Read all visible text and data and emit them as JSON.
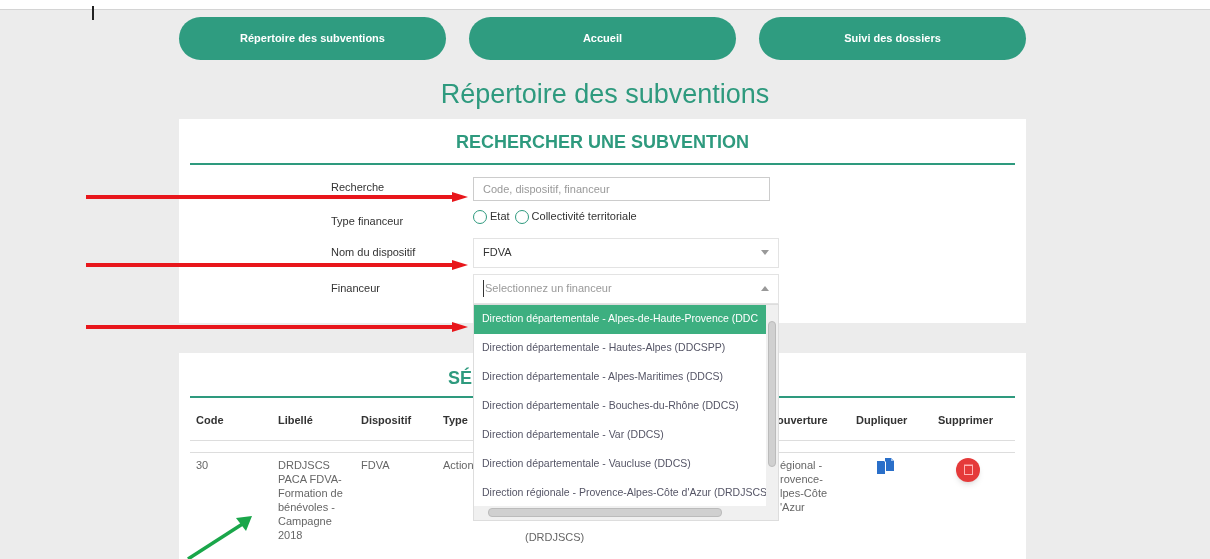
{
  "nav": [
    "Répertoire des subventions",
    "Accueil",
    "Suivi des dossiers"
  ],
  "title": "Répertoire des subventions",
  "search_card": {
    "heading": "RECHERCHER UNE SUBVENTION",
    "fields": [
      {
        "kind": "text",
        "label": "Recherche",
        "placeholder": "Code, dispositif, financeur"
      },
      {
        "kind": "radio",
        "label": "Type financeur",
        "options": [
          {
            "label": "Etat",
            "selected": false
          },
          {
            "label": "Collectivité territoriale",
            "selected": false
          }
        ]
      },
      {
        "kind": "select",
        "label": "Nom du dispositif",
        "value": "FDVA",
        "expanded": false
      },
      {
        "kind": "select",
        "label": "Financeur",
        "placeholder": "Selectionnez un financeur",
        "expanded": true,
        "options": [
          {
            "label": "Direction départementale - Alpes-de-Haute-Provence (DDC",
            "selected": true
          },
          {
            "label": "Direction départementale - Hautes-Alpes (DDCSPP)",
            "selected": false
          },
          {
            "label": "Direction départementale - Alpes-Maritimes (DDCS)",
            "selected": false
          },
          {
            "label": "Direction départementale - Bouches-du-Rhône (DDCS)",
            "selected": false
          },
          {
            "label": "Direction départementale - Var (DDCS)",
            "selected": false
          },
          {
            "label": "Direction départementale - Vaucluse (DDCS)",
            "selected": false
          },
          {
            "label": "Direction régionale - Provence-Alpes-Côte d'Azur (DRDJSCS",
            "selected": false
          }
        ]
      }
    ]
  },
  "results_card": {
    "heading": "SÉ",
    "columns": [
      "Code",
      "Libellé",
      "Dispositif",
      "Type",
      "ouverture",
      "Dupliquer",
      "Supprimer"
    ],
    "rows": [
      {
        "code": "30",
        "libelle": "DRDJSCS PACA FDVA-Formation de bénévoles - Campagne 2018",
        "dispositif": "FDVA",
        "type": "Action",
        "financeur": "(DRDJSCS)",
        "ouverture": [
          "égional -",
          "rovence-",
          "lpes-Côte",
          "'Azur"
        ]
      }
    ]
  },
  "annotations": [
    {
      "kind": "horizontal"
    },
    {
      "kind": "horizontal"
    },
    {
      "kind": "horizontal"
    },
    {
      "kind": "diagonal"
    }
  ]
}
